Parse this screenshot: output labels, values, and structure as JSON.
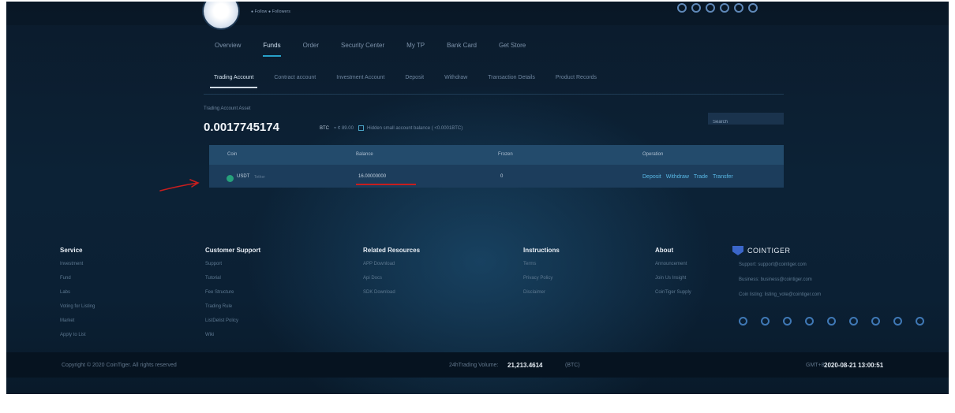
{
  "user": {
    "tags": "● Follow ● Followers"
  },
  "nav": [
    {
      "label": "Overview",
      "active": false
    },
    {
      "label": "Funds",
      "active": true
    },
    {
      "label": "Order",
      "active": false
    },
    {
      "label": "Security Center",
      "active": false
    },
    {
      "label": "My TP",
      "active": false
    },
    {
      "label": "Bank Card",
      "active": false
    },
    {
      "label": "Get Store",
      "active": false
    }
  ],
  "subnav": [
    {
      "label": "Trading Account",
      "active": true
    },
    {
      "label": "Contract account",
      "active": false
    },
    {
      "label": "Investment Account",
      "active": false
    },
    {
      "label": "Deposit",
      "active": false
    },
    {
      "label": "Withdraw",
      "active": false
    },
    {
      "label": "Transaction Details",
      "active": false
    },
    {
      "label": "Product Records",
      "active": false
    }
  ],
  "asset": {
    "label": "Trading Account Asset",
    "value": "0.0017745174",
    "unit": "BTC",
    "cny": "≈ ¢ 89.00",
    "hide_text": "Hidden small account balance ( <0.0001BTC)"
  },
  "search": {
    "placeholder": "Search"
  },
  "table": {
    "headers": [
      "Coin",
      "Balance",
      "Frozen",
      "Operation"
    ],
    "row": {
      "coin": "USDT",
      "coin_sub": "Tether",
      "balance": "16.00000000",
      "frozen": "0"
    },
    "ops": [
      "Deposit",
      "Withdraw",
      "Trade",
      "Transfer"
    ]
  },
  "footer": {
    "service": {
      "title": "Service",
      "links": [
        "Investment",
        "Fund",
        "Labs",
        "Voting for Listing",
        "Market",
        "Apply to List"
      ]
    },
    "support": {
      "title": "Customer Support",
      "links": [
        "Support",
        "Tutorial",
        "Fee Structure",
        "Trading Rule",
        "ListDelist Policy",
        "Wiki"
      ]
    },
    "resources": {
      "title": "Related Resources",
      "links": [
        "APP Download",
        "Api Docs",
        "SDK Download"
      ]
    },
    "instructions": {
      "title": "Instructions",
      "links": [
        "Terms",
        "Privacy Policy",
        "Disclaimer"
      ]
    },
    "about": {
      "title": "About",
      "links": [
        "Announcement",
        "Join Us Insight",
        "CoinTiger Supply"
      ]
    },
    "brand": "COINTIGER",
    "contacts": [
      "Support: support@cointiger.com",
      "Business: business@cointiger.com",
      "Coin listing: listing_vote@cointiger.com"
    ]
  },
  "bottom": {
    "copyright": "Copyright © 2020 CoinTiger. All rights reserved",
    "volume_label": "24hTrading Volume:",
    "volume_value": "21,213.4614",
    "volume_unit": "(BTC)",
    "gmt_label": "GMT+8",
    "gmt_value": "2020-08-21 13:00:51"
  }
}
